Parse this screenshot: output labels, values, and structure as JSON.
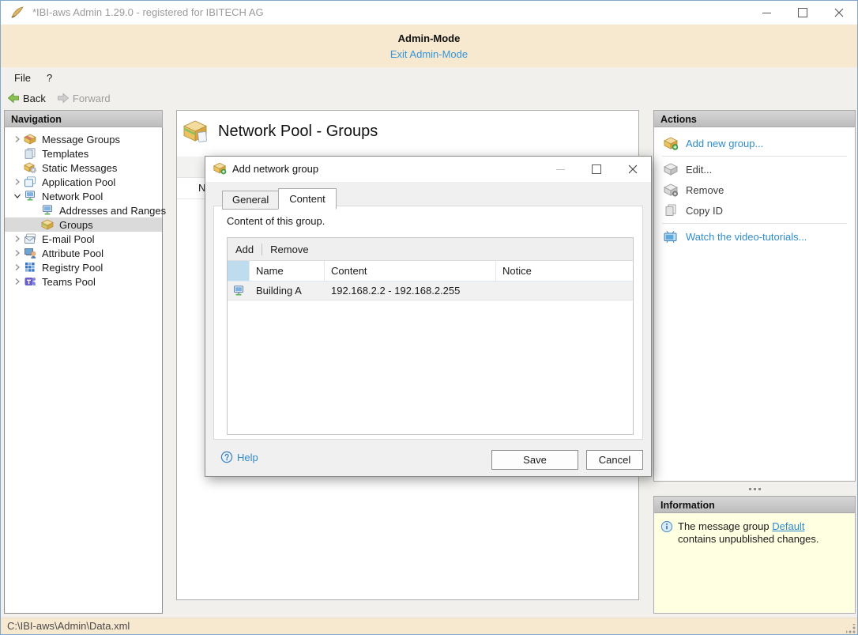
{
  "window": {
    "title": "*IBI-aws Admin 1.29.0 - registered for IBITECH AG"
  },
  "admin_banner": {
    "title": "Admin-Mode",
    "exit_link": "Exit Admin-Mode",
    "background": "#F7E8D0"
  },
  "menu": {
    "file": "File",
    "help": "?"
  },
  "toolbar": {
    "back": "Back",
    "forward": "Forward"
  },
  "navigation": {
    "header": "Navigation",
    "items": [
      {
        "label": "Message Groups",
        "icon": "message-groups",
        "expander": "collapsed",
        "level": 0
      },
      {
        "label": "Templates",
        "icon": "templates",
        "expander": "none",
        "level": 0
      },
      {
        "label": "Static Messages",
        "icon": "static-messages",
        "expander": "none",
        "level": 0
      },
      {
        "label": "Application Pool",
        "icon": "application-pool",
        "expander": "collapsed",
        "level": 0
      },
      {
        "label": "Network Pool",
        "icon": "network-pool",
        "expander": "expanded",
        "level": 0
      },
      {
        "label": "Addresses and Ranges",
        "icon": "network-address",
        "expander": "none",
        "level": 1
      },
      {
        "label": "Groups",
        "icon": "group-package",
        "expander": "none",
        "level": 1,
        "selected": true
      },
      {
        "label": "E-mail Pool",
        "icon": "email-pool",
        "expander": "collapsed",
        "level": 0
      },
      {
        "label": "Attribute Pool",
        "icon": "attribute-pool",
        "expander": "collapsed",
        "level": 0
      },
      {
        "label": "Registry Pool",
        "icon": "registry-pool",
        "expander": "collapsed",
        "level": 0
      },
      {
        "label": "Teams Pool",
        "icon": "teams-pool",
        "expander": "collapsed",
        "level": 0
      }
    ]
  },
  "main": {
    "title": "Network Pool - Groups",
    "partial_column_label": "N"
  },
  "actions": {
    "header": "Actions",
    "add_new_group": "Add new group...",
    "edit": "Edit...",
    "remove": "Remove",
    "copy_id": "Copy ID",
    "video_tutorials": "Watch the video-tutorials..."
  },
  "information": {
    "header": "Information",
    "text_prefix": "The message group ",
    "link": "Default",
    "text_suffix": " contains unpublished changes."
  },
  "status_bar": {
    "path": "C:\\IBI-aws\\Admin\\Data.xml"
  },
  "dialog": {
    "title": "Add network group",
    "tabs": [
      {
        "label": "General",
        "active": false
      },
      {
        "label": "Content",
        "active": true
      }
    ],
    "description": "Content of this group.",
    "table_toolbar": {
      "add": "Add",
      "remove": "Remove"
    },
    "table": {
      "columns": [
        {
          "label": "",
          "type": "icon"
        },
        {
          "label": "Name"
        },
        {
          "label": "Content"
        },
        {
          "label": "Notice"
        }
      ],
      "rows": [
        {
          "icon": "network-address",
          "name": "Building A",
          "content": "192.168.2.2 - 192.168.2.255",
          "notice": ""
        }
      ]
    },
    "help": "Help",
    "save": "Save",
    "cancel": "Cancel"
  },
  "colors": {
    "accent_link": "#2E8BCC",
    "banner_bg": "#F7E8D0",
    "info_bg": "#FFFFE1",
    "selected_item_bg": "#DADADA",
    "header_icon_cell_bg": "#BFDCEF"
  }
}
